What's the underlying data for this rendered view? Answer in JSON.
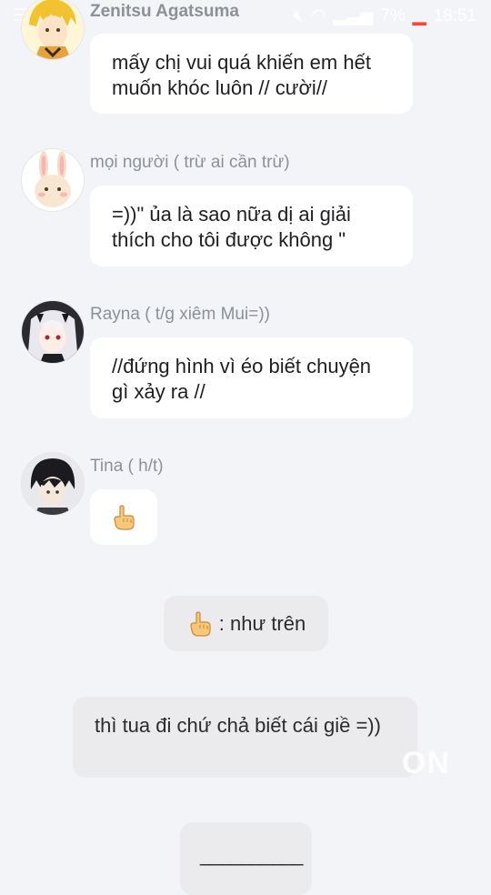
{
  "status_bar": {
    "battery": "7%",
    "time": "18:51"
  },
  "messages": [
    {
      "sender": "Zenitsu Agatsuma",
      "text": "mấy chị vui quá khiến em hết muốn khóc luôn // cười//"
    },
    {
      "sender": "mọi người ( trừ ai cần trừ)",
      "text": "=))\" ủa là sao nữa dị ai giải thích cho tôi được không \""
    },
    {
      "sender": "Rayna ( t/g xiêm Mui=))",
      "text": "//đứng hình vì éo biết chuyện gì xảy ra //"
    },
    {
      "sender": "Tina ( h/t)",
      "icon": "pointing-hand-icon"
    }
  ],
  "narration": [
    {
      "text": ": như trên",
      "icon": "pointing-hand-icon"
    },
    {
      "text": "thì tua đi chứ chả biết cái giề =))"
    },
    {
      "text": "__________"
    }
  ],
  "watermark": "ON"
}
